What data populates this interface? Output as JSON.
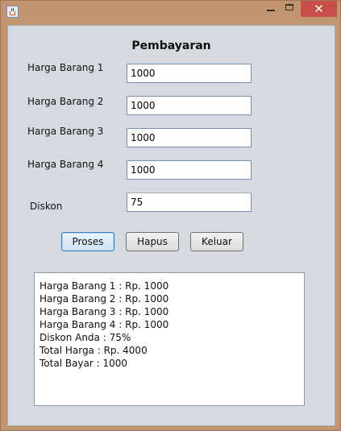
{
  "window": {
    "controls": {
      "minimize": "",
      "maximize": "",
      "close": "✕"
    }
  },
  "form": {
    "title": "Pembayaran",
    "fields": [
      {
        "label": "Harga Barang 1",
        "value": "1000"
      },
      {
        "label": "Harga Barang 2",
        "value": "1000"
      },
      {
        "label": "Harga Barang 3",
        "value": "1000"
      },
      {
        "label": "Harga Barang 4",
        "value": "1000"
      },
      {
        "label": "Diskon",
        "value": "75"
      }
    ],
    "buttons": {
      "proses": "Proses",
      "hapus": "Hapus",
      "keluar": "Keluar"
    }
  },
  "output": {
    "lines": [
      "Harga Barang 1 : Rp. 1000",
      "Harga Barang 2 : Rp. 1000",
      "Harga Barang 3 : Rp. 1000",
      "Harga Barang 4 : Rp. 1000",
      "Diskon Anda : 75%",
      "Total Harga : Rp. 4000",
      "Total Bayar : 1000"
    ]
  }
}
